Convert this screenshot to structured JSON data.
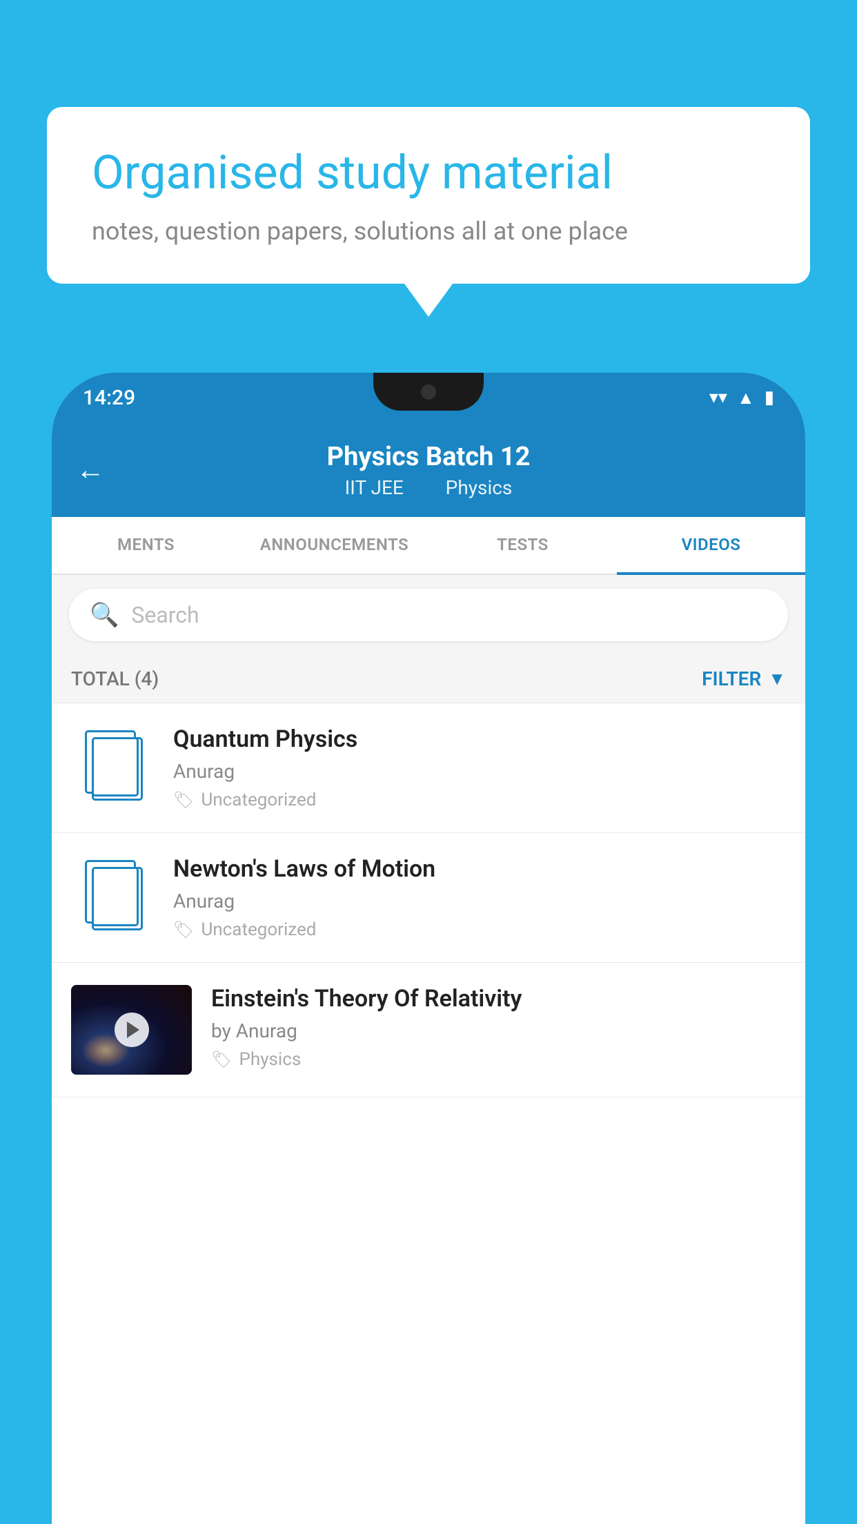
{
  "background": {
    "color": "#29b6e8"
  },
  "speech_bubble": {
    "title": "Organised study material",
    "subtitle": "notes, question papers, solutions all at one place"
  },
  "status_bar": {
    "time": "14:29",
    "wifi": "▼",
    "signal": "▲",
    "battery": "▮"
  },
  "app_header": {
    "back_label": "←",
    "title": "Physics Batch 12",
    "subtitle_part1": "IIT JEE",
    "subtitle_part2": "Physics"
  },
  "tabs": {
    "items": [
      {
        "label": "MENTS",
        "active": false
      },
      {
        "label": "ANNOUNCEMENTS",
        "active": false
      },
      {
        "label": "TESTS",
        "active": false
      },
      {
        "label": "VIDEOS",
        "active": true
      }
    ]
  },
  "search": {
    "placeholder": "Search"
  },
  "filter_row": {
    "total_label": "TOTAL (4)",
    "filter_label": "FILTER"
  },
  "video_list": {
    "items": [
      {
        "id": "1",
        "type": "doc",
        "title": "Quantum Physics",
        "author": "Anurag",
        "tag": "Uncategorized"
      },
      {
        "id": "2",
        "type": "doc",
        "title": "Newton's Laws of Motion",
        "author": "Anurag",
        "tag": "Uncategorized"
      },
      {
        "id": "3",
        "type": "thumb",
        "title": "Einstein's Theory Of Relativity",
        "author": "by Anurag",
        "tag": "Physics"
      }
    ]
  }
}
